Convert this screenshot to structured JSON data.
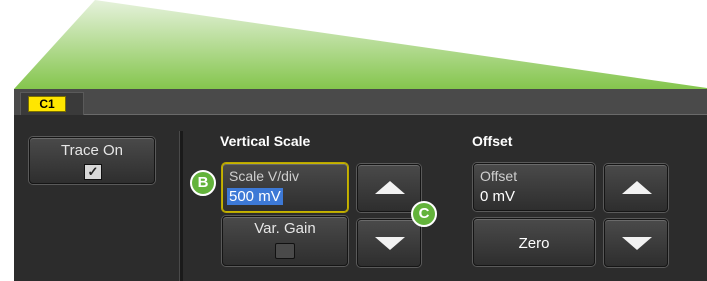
{
  "tab": {
    "label": "C1"
  },
  "trace": {
    "button_label": "Trace On",
    "checked": true
  },
  "vertical_scale": {
    "section_title": "Vertical Scale",
    "field_label": "Scale V/div",
    "field_value": "500 mV",
    "var_gain_label": "Var. Gain"
  },
  "offset": {
    "section_title": "Offset",
    "field_label": "Offset",
    "field_value": "0 mV",
    "zero_label": "Zero"
  },
  "annotations": {
    "b": "B",
    "c": "C"
  },
  "colors": {
    "callout_green": "#7dc242",
    "tab_yellow": "#ffe600",
    "selection_blue": "#3d79d6",
    "badge_green": "#63b33b"
  },
  "icons": {
    "up": "triangle-up-icon",
    "down": "triangle-down-icon",
    "check": "checkmark-icon"
  }
}
